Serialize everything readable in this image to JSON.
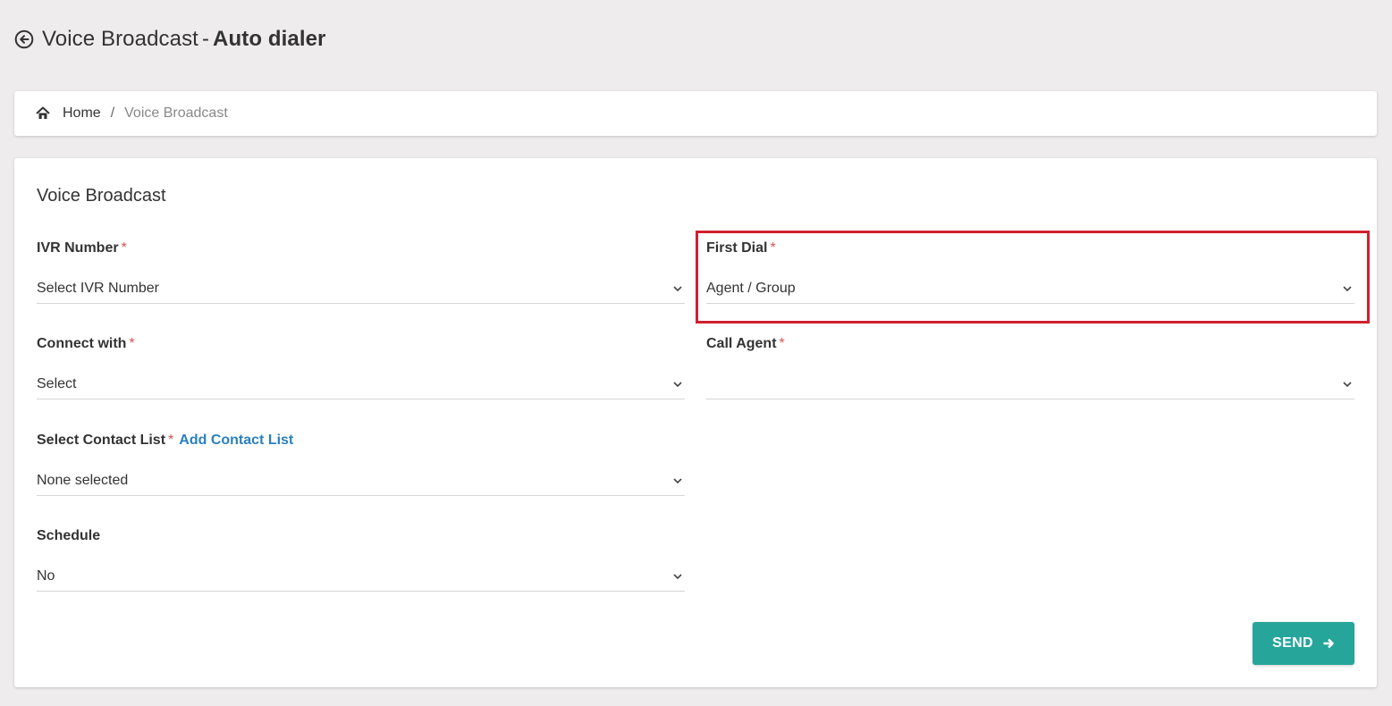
{
  "header": {
    "title_main": "Voice Broadcast",
    "title_sep": "-",
    "title_bold": "Auto dialer"
  },
  "breadcrumb": {
    "home": "Home",
    "separator": "/",
    "current": "Voice Broadcast"
  },
  "form": {
    "title": "Voice Broadcast",
    "required_mark": "*",
    "ivr_number": {
      "label": "IVR Number",
      "value": "Select IVR Number"
    },
    "first_dial": {
      "label": "First Dial",
      "value": "Agent / Group"
    },
    "connect_with": {
      "label": "Connect with",
      "value": "Select"
    },
    "call_agent": {
      "label": "Call Agent",
      "value": ""
    },
    "contact_list": {
      "label": "Select Contact List",
      "link": "Add Contact List",
      "value": "None selected"
    },
    "schedule": {
      "label": "Schedule",
      "value": "No"
    },
    "send_label": "SEND"
  },
  "colors": {
    "background": "#eeeced",
    "accent": "#26a69a",
    "required": "#d9534f",
    "link": "#2a7fbf",
    "highlight": "#d0202e"
  }
}
